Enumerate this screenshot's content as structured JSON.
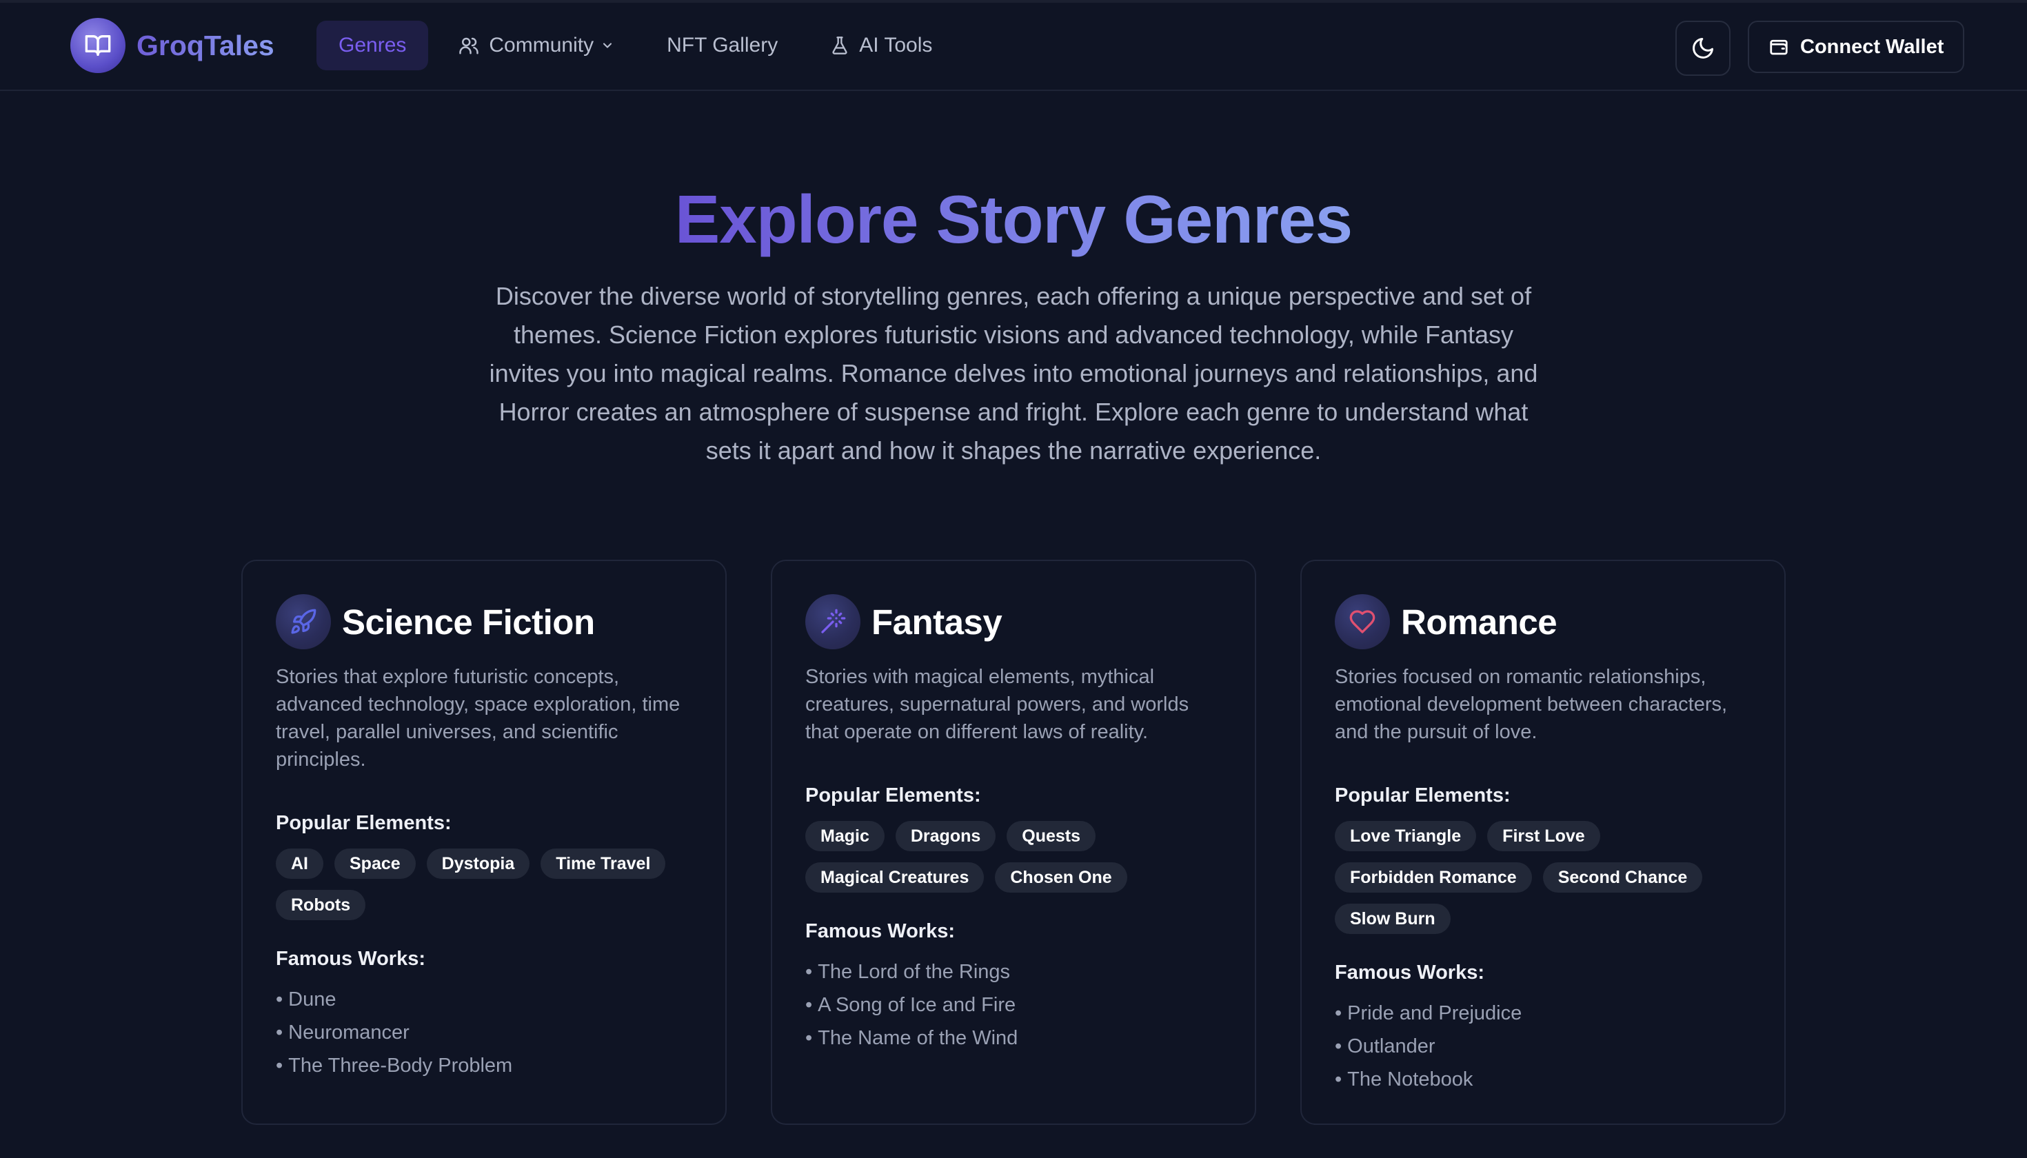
{
  "brand": {
    "name": "GroqTales",
    "icon": "book-open-icon"
  },
  "nav": [
    {
      "label": "Genres",
      "active": true
    },
    {
      "label": "Community",
      "icon": "users-icon",
      "has_dropdown": true
    },
    {
      "label": "NFT Gallery"
    },
    {
      "label": "AI Tools",
      "icon": "flask-icon"
    }
  ],
  "header_actions": {
    "theme_icon": "moon-icon",
    "wallet_label": "Connect Wallet",
    "wallet_icon": "wallet-icon"
  },
  "hero": {
    "title": "Explore Story Genres",
    "description": "Discover the diverse world of storytelling genres, each offering a unique perspective and set of themes. Science Fiction explores futuristic visions and advanced technology, while Fantasy invites you into magical realms. Romance delves into emotional journeys and relationships, and Horror creates an atmosphere of suspense and fright. Explore each genre to understand what sets it apart and how it shapes the narrative experience."
  },
  "labels": {
    "popular": "Popular Elements:",
    "famous": "Famous Works:"
  },
  "genres": [
    {
      "title": "Science Fiction",
      "icon": "rocket-icon",
      "description": "Stories that explore futuristic concepts, advanced technology, space exploration, time travel, parallel universes, and scientific principles.",
      "tags": [
        "AI",
        "Space",
        "Dystopia",
        "Time Travel",
        "Robots"
      ],
      "works": [
        "Dune",
        "Neuromancer",
        "The Three-Body Problem"
      ]
    },
    {
      "title": "Fantasy",
      "icon": "wand-icon",
      "description": "Stories with magical elements, mythical creatures, supernatural powers, and worlds that operate on different laws of reality.",
      "tags": [
        "Magic",
        "Dragons",
        "Quests",
        "Magical Creatures",
        "Chosen One"
      ],
      "works": [
        "The Lord of the Rings",
        "A Song of Ice and Fire",
        "The Name of the Wind"
      ]
    },
    {
      "title": "Romance",
      "icon": "heart-icon",
      "description": "Stories focused on romantic relationships, emotional development between characters, and the pursuit of love.",
      "tags": [
        "Love Triangle",
        "First Love",
        "Forbidden Romance",
        "Second Chance",
        "Slow Burn"
      ],
      "works": [
        "Pride and Prejudice",
        "Outlander",
        "The Notebook"
      ]
    }
  ],
  "colors": {
    "background": "#0f1424",
    "accent": "#7a5ef0",
    "tag_bg": "#222838"
  }
}
